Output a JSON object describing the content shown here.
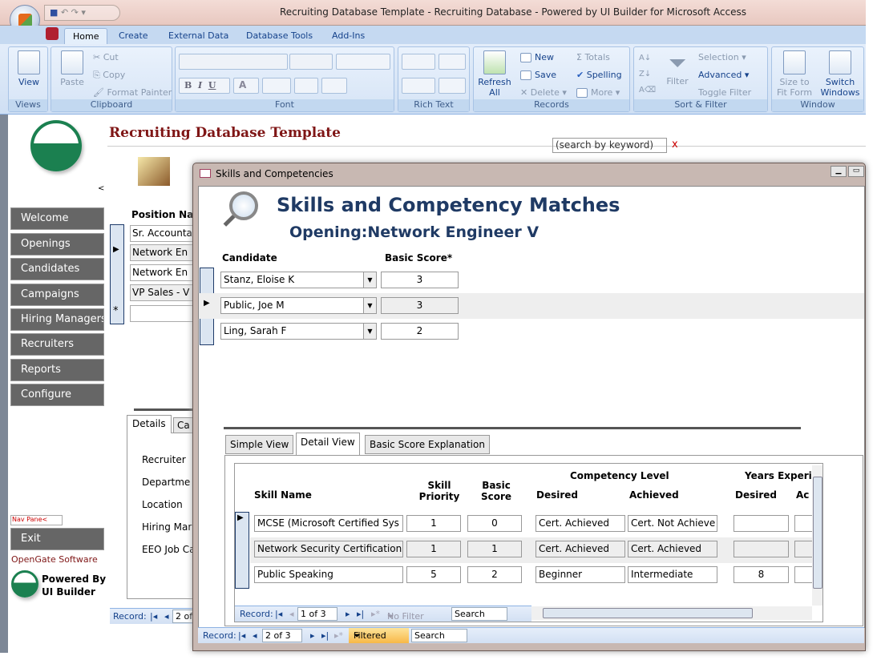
{
  "window": {
    "title": "Recruiting Database Template - Recruiting Database - Powered by UI Builder for Microsoft Access"
  },
  "ribbon": {
    "tabs": [
      "Home",
      "Create",
      "External Data",
      "Database Tools",
      "Add-Ins"
    ],
    "views": {
      "view": "View",
      "label": "Views"
    },
    "clipboard": {
      "paste": "Paste",
      "cut": "Cut",
      "copy": "Copy",
      "format_painter": "Format Painter",
      "label": "Clipboard"
    },
    "font": {
      "label": "Font",
      "bold": "B",
      "italic": "I",
      "underline": "U",
      "font_color": "A"
    },
    "rich_text": {
      "label": "Rich Text"
    },
    "records": {
      "refresh": "Refresh All",
      "new": "New",
      "save": "Save",
      "delete": "Delete",
      "totals": "Totals",
      "spelling": "Spelling",
      "more": "More",
      "label": "Records"
    },
    "sort_filter": {
      "filter": "Filter",
      "selection": "Selection",
      "advanced": "Advanced",
      "toggle_filter": "Toggle Filter",
      "label": "Sort & Filter"
    },
    "window": {
      "size_to_fit": "Size to Fit Form",
      "switch_windows": "Switch Windows",
      "label": "Window"
    }
  },
  "nav": {
    "collapse": "<",
    "items": [
      "Welcome",
      "Openings",
      "Candidates",
      "Campaigns",
      "Hiring Managers",
      "Recruiters",
      "Reports",
      "Configure"
    ],
    "nav_pane": "Nav Pane<",
    "exit": "Exit",
    "company": "OpenGate Software",
    "powered_by": "Powered By",
    "ui_builder": "UI Builder"
  },
  "main": {
    "title": "Recruiting Database Template",
    "search_placeholder": "(search by keyword)",
    "search_clear": "x",
    "position_header": "Position Na",
    "positions": [
      "Sr. Accounta",
      "Network En",
      "Network En",
      "VP Sales - V",
      ""
    ],
    "tabs": [
      "Details",
      "Ca"
    ],
    "detail_labels": [
      "Recruiter",
      "Departme",
      "Location",
      "Hiring Mar",
      "EEO Job Ca"
    ],
    "record_nav": {
      "label": "Record:",
      "position": "2 of"
    }
  },
  "popup": {
    "title": "Skills and Competencies",
    "heading": "Skills and Competency Matches",
    "opening_label": "Opening:",
    "opening_value": "Network Engineer V",
    "candidate_header": "Candidate",
    "score_header": "Basic Score*",
    "candidates": [
      {
        "name": "Stanz, Eloise K",
        "score": "3"
      },
      {
        "name": "Public, Joe M",
        "score": "3"
      },
      {
        "name": "Ling, Sarah F",
        "score": "2"
      }
    ],
    "tabs": [
      "Simple View",
      "Detail View",
      "Basic Score Explanation"
    ],
    "grid": {
      "headers": {
        "skill_name": "Skill Name",
        "skill_priority": "Skill Priority",
        "basic_score": "Basic Score",
        "competency_level": "Competency Level",
        "years_experience": "Years Experi",
        "desired": "Desired",
        "achieved": "Achieved",
        "desired2": "Desired",
        "achieved2": "Ac"
      },
      "rows": [
        {
          "skill": "MCSE (Microsoft Certified Sys",
          "priority": "1",
          "score": "0",
          "desired": "Cert. Achieved",
          "achieved": "Cert. Not Achieve",
          "years_desired": ""
        },
        {
          "skill": "Network Security Certification",
          "priority": "1",
          "score": "1",
          "desired": "Cert. Achieved",
          "achieved": "Cert. Achieved",
          "years_desired": ""
        },
        {
          "skill": "Public Speaking",
          "priority": "5",
          "score": "2",
          "desired": "Beginner",
          "achieved": "Intermediate",
          "years_desired": "8"
        }
      ]
    },
    "sub_record_nav": {
      "label": "Record:",
      "position": "1 of 3",
      "filter": "No Filter",
      "search": "Search"
    },
    "record_nav": {
      "label": "Record:",
      "position": "2 of 3",
      "filter": "Filtered",
      "search": "Search"
    }
  }
}
